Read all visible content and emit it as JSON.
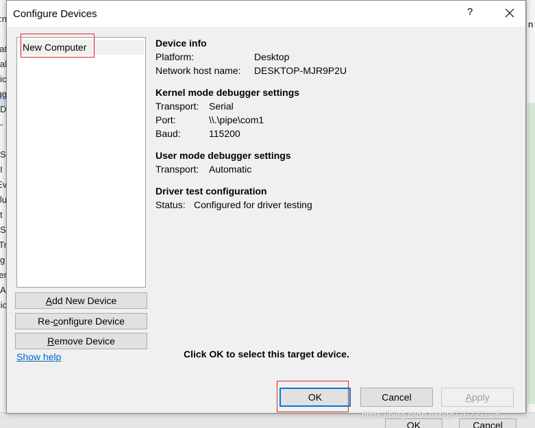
{
  "background": {
    "left_fragments": [
      "n:",
      "at",
      "al",
      "ic",
      "gg",
      "D",
      "-",
      "S",
      "I",
      "Ev",
      "olu",
      "t",
      "S",
      "Tr",
      "g",
      "ler",
      "A",
      "lic"
    ],
    "right_fragment": "n",
    "buttons": {
      "ok": "OK",
      "cancel": "Cancel"
    }
  },
  "dialog": {
    "title": "Configure Devices",
    "help_glyph": "?",
    "devices": [
      "New Computer"
    ],
    "device_info": {
      "heading": "Device info",
      "platform_label": "Platform:",
      "platform_value": "Desktop",
      "host_label": "Network host name:",
      "host_value": "DESKTOP-MJR9P2U"
    },
    "kernel": {
      "heading": "Kernel mode debugger settings",
      "transport_label": "Transport:",
      "transport_value": "Serial",
      "port_label": "Port:",
      "port_value": "\\\\.\\pipe\\com1",
      "baud_label": "Baud:",
      "baud_value": "115200"
    },
    "user": {
      "heading": "User mode debugger settings",
      "transport_label": "Transport:",
      "transport_value": "Automatic"
    },
    "driver": {
      "heading": "Driver test configuration",
      "status_label": "Status:",
      "status_value": "Configured for driver testing"
    },
    "buttons": {
      "add": {
        "access_key": "A",
        "rest": "dd New Device"
      },
      "reconfigure": {
        "pre": "Re-",
        "access_key": "c",
        "rest": "onfigure Device"
      },
      "remove": {
        "access_key": "R",
        "rest": "emove Device"
      },
      "ok": "OK",
      "cancel": "Cancel",
      "apply": {
        "access_key": "A",
        "rest": "pply"
      }
    },
    "show_help": "Show help",
    "hint": "Click OK to select this target device."
  },
  "watermark": "https://blog.csdn.net/qq7262321..ld",
  "colors": {
    "highlight_box": "#d9262c",
    "link": "#0066cc",
    "ok_border": "#0078d7"
  }
}
